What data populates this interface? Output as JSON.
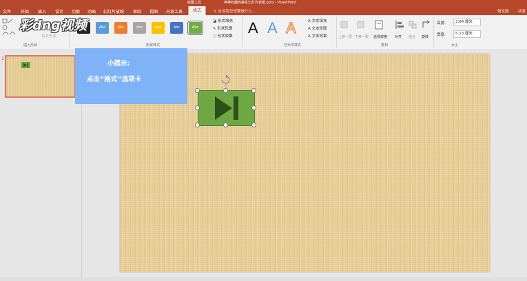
{
  "titlebar": {
    "context_tools": "绘图工具",
    "document_title": "神神有趣的美化幻灯片表组.pptx - PowerPoint"
  },
  "tabs": [
    {
      "label": "文件"
    },
    {
      "label": "开始"
    },
    {
      "label": "插入"
    },
    {
      "label": "设计"
    },
    {
      "label": "切换"
    },
    {
      "label": "动画"
    },
    {
      "label": "幻灯片放映"
    },
    {
      "label": "审阅"
    },
    {
      "label": "视图"
    },
    {
      "label": "开发工具"
    },
    {
      "label": "格式",
      "active": true
    }
  ],
  "tell_me": "告诉我您想要做什么...",
  "account": "何文辰",
  "share": "共享",
  "ribbon": {
    "groups": {
      "insert_shapes": "插入形状",
      "shape_styles": "形状样式",
      "wordart_styles": "艺术字样式",
      "arrange": "排列",
      "size": "大小"
    },
    "merge_shapes": "合并形状",
    "style_swatches": [
      {
        "label": "Abc",
        "color": "#222222"
      },
      {
        "label": "Abc",
        "color": "#5b9bd5"
      },
      {
        "label": "Abc",
        "color": "#ed7d31"
      },
      {
        "label": "Abc",
        "color": "#a5a5a5"
      },
      {
        "label": "Abc",
        "color": "#ffc000"
      },
      {
        "label": "Abc",
        "color": "#4472c4"
      },
      {
        "label": "Abc",
        "color": "#70ad47"
      }
    ],
    "shape_fill": "形状填充",
    "shape_outline": "形状轮廓",
    "shape_effects": "形状效果",
    "wordart_letters": [
      "A",
      "A",
      "A"
    ],
    "text_fill": "文本填充",
    "text_outline": "文本轮廓",
    "text_effects": "文本效果",
    "arrange_cmds": {
      "bring_forward": "上移一层",
      "send_backward": "下移一层",
      "selection_pane": "选择窗格",
      "align": "对齐",
      "group": "组合",
      "rotate": "旋转"
    },
    "size": {
      "height_label": "高度:",
      "height_value": "2.84 厘米",
      "width_label": "宽度:",
      "width_value": "5.13 厘米"
    }
  },
  "watermark": "彩dng视频",
  "thumbnail": {
    "number": "1"
  },
  "tip": {
    "title": "小提示:",
    "text": "点击“格式”选项卡"
  },
  "colors": {
    "brand": "#b7472a",
    "tip_bg": "#7fb2f6",
    "shape_fill": "#6ea843",
    "shape_icon": "#2e4f1c"
  },
  "shape_icon_name": "play-next-icon"
}
